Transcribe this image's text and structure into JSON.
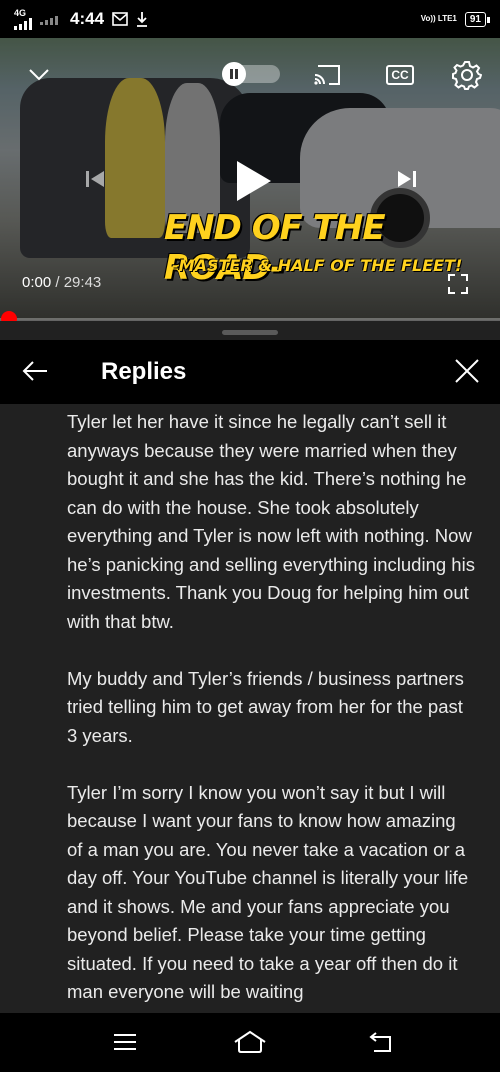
{
  "status_bar": {
    "network": "4G",
    "time": "4:44",
    "volte": "Vo)) LTE1",
    "battery": "91"
  },
  "video": {
    "overlay_title": "END OF THE ROAD-",
    "overlay_subtitle": "-MASTER & HALF OF THE FLEET!",
    "current_time": "0:00",
    "duration": "29:43",
    "progress_fraction": 0.0,
    "icons": {
      "collapse": "chevron-down-icon",
      "pause": "pause-icon",
      "cast": "cast-icon",
      "captions": "cc-icon",
      "settings": "gear-icon",
      "previous": "skip-previous-icon",
      "play": "play-icon",
      "next": "skip-next-icon",
      "fullscreen": "fullscreen-icon"
    },
    "cc_label": "CC"
  },
  "panel": {
    "title": "Replies",
    "comment_paragraphs": [
      "Tyler let her have it since he legally can’t sell it anyways because they were married when they bought it and she has the kid. There’s nothing he can do with the house. She took absolutely everything and Tyler is now left with nothing. Now he’s panicking and selling everything including his investments. Thank you Doug for helping him out with that btw.",
      "My buddy and Tyler’s friends / business partners tried telling him to get away from her for the past 3 years.",
      "Tyler I’m sorry I know you won’t say it but I will because I want your fans to know how amazing of a man you are. You never take a vacation or a day off. Your YouTube channel is literally your life and it shows. Me and your fans appreciate you beyond belief. Please take your time getting situated. If you need to take a year off then do it man everyone will be waiting"
    ]
  },
  "colors": {
    "progress": "#ff0000",
    "title_yellow": "#ffd21e",
    "panel_bg": "#212121",
    "header_bg": "#000000"
  }
}
